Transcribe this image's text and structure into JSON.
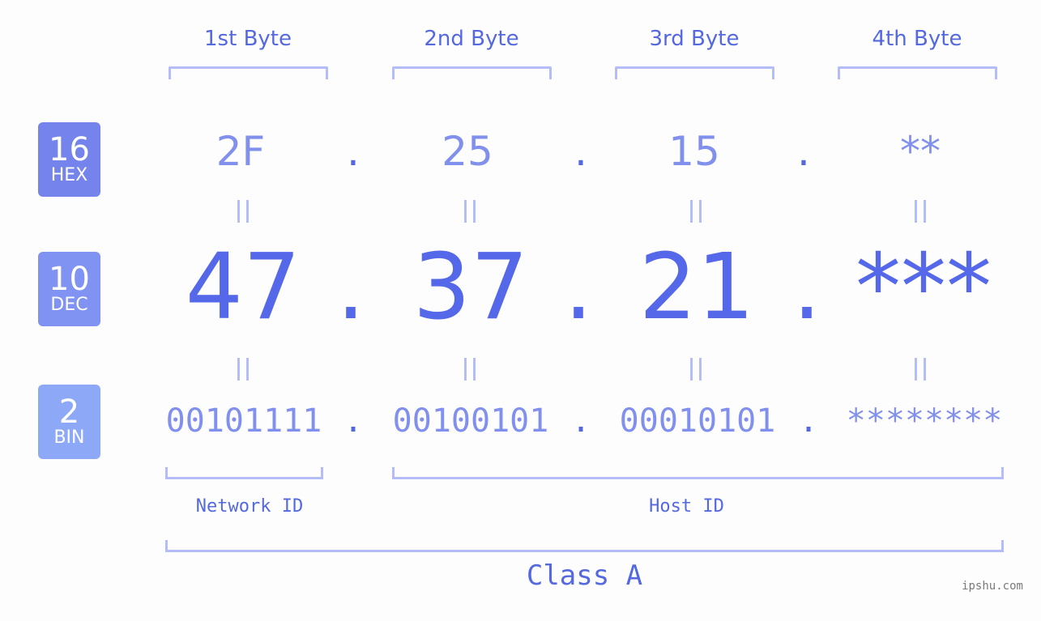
{
  "byte_headers": [
    "1st Byte",
    "2nd Byte",
    "3rd Byte",
    "4th Byte"
  ],
  "bases": [
    {
      "number": "16",
      "label": "HEX",
      "color": "#7584ec"
    },
    {
      "number": "10",
      "label": "DEC",
      "color": "#8092f2"
    },
    {
      "number": "2",
      "label": "BIN",
      "color": "#8ea8f8"
    }
  ],
  "hex": [
    "2F",
    "25",
    "15",
    "**"
  ],
  "dec": [
    "47",
    "37",
    "21",
    "***"
  ],
  "bin": [
    "00101111",
    "00100101",
    "00010101",
    "********"
  ],
  "separator": ".",
  "equals_symbol": "=",
  "segments": {
    "network_label": "Network ID",
    "host_label": "Host ID"
  },
  "class_label": "Class A",
  "watermark": "ipshu.com",
  "colors": {
    "accent": "#5468e9",
    "light_accent": "#8090ec",
    "bracket": "#b4bdf8",
    "background": "#fcfdfc"
  }
}
